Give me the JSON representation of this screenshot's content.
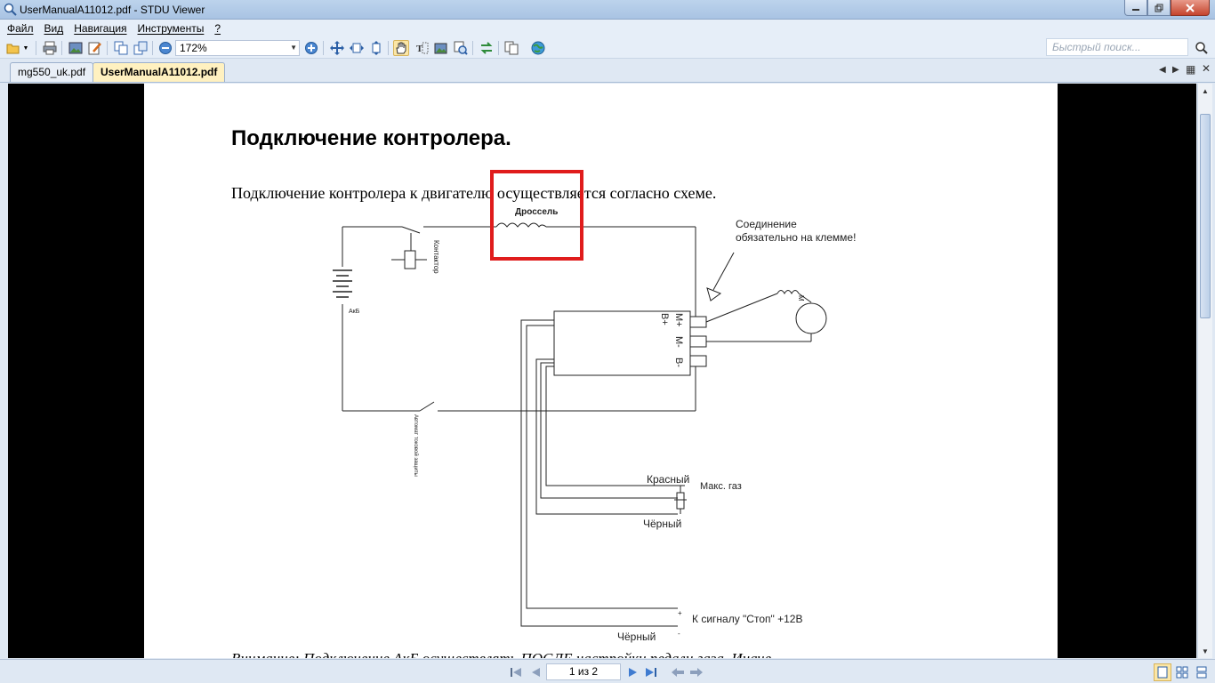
{
  "window": {
    "title": "UserManualA11012.pdf - STDU Viewer"
  },
  "menu": [
    "Файл",
    "Вид",
    "Навигация",
    "Инструменты",
    "?"
  ],
  "toolbar": {
    "zoom_value": "172%",
    "search_placeholder": "Быстрый поиск...",
    "icons": [
      "open-icon",
      "print-icon",
      "image-icon",
      "edit-icon",
      "copy-icon",
      "paste-icon",
      "zoom-out-icon",
      "zoom-in-icon",
      "fit-page-icon",
      "fit-width-icon",
      "fit-height-icon",
      "hand-tool-icon",
      "select-text-icon",
      "select-image-icon",
      "magnifier-icon",
      "swap-icon",
      "pages-icon",
      "web-icon"
    ]
  },
  "tabs": [
    {
      "label": "mg550_uk.pdf",
      "selected": false
    },
    {
      "label": "UserManualA11012.pdf",
      "selected": true
    }
  ],
  "document": {
    "heading": "Подключение контролера.",
    "subtitle": "Подключение контролера к двигателю осуществляется согласно схеме.",
    "footer_partial": "Внимание: Подключение АкБ осуществлять ПОСЛЕ настройки педали газа. Иначе",
    "diagram_labels": {
      "choke": "Дроссель",
      "connection_note_1": "Соединение",
      "connection_note_2": "обязательно на клемме!",
      "contactor": "Контактор",
      "battery": "АкБ",
      "breaker": "Автомат токовой защиты",
      "m_plus": "M+",
      "b_plus": "B+",
      "m_minus": "M-",
      "b_minus": "B-",
      "motor": "М",
      "red": "Красный",
      "max_gas": "Макс. газ",
      "black1": "Чёрный",
      "stop_signal": "К сигналу \"Стоп\" +12В",
      "plus": "+",
      "minus": "-",
      "black2": "Чёрный"
    },
    "highlight_color": "#e01c1c"
  },
  "status": {
    "page_indicator": "1 из 2"
  }
}
